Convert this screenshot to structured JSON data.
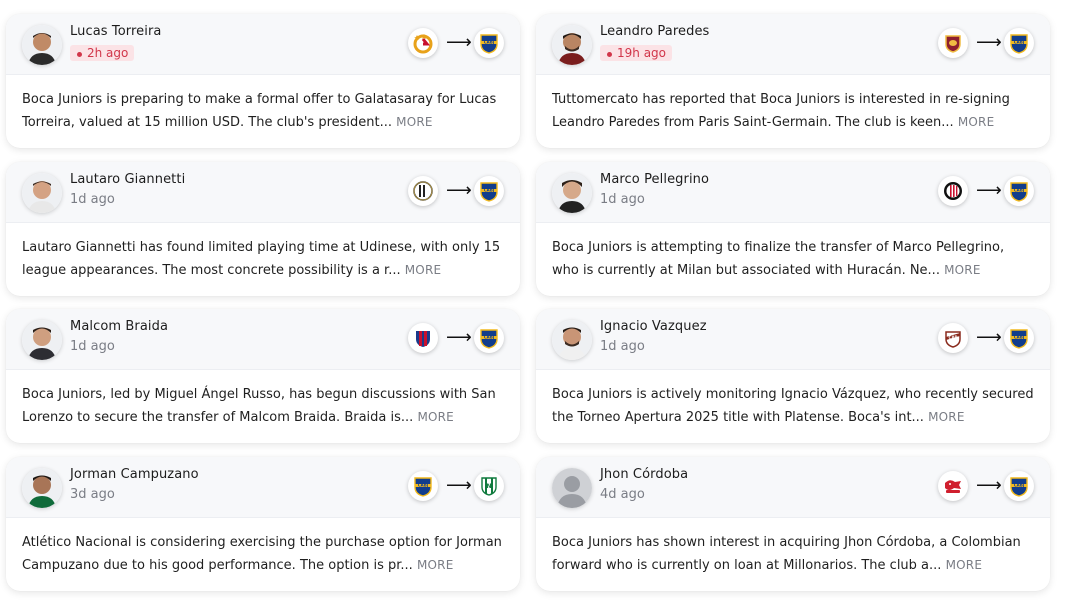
{
  "cards": [
    {
      "player": "Lucas Torreira",
      "time": "2h ago",
      "from_club": "galatasaray-crest-icon",
      "to_club": "boca-juniors-crest-icon",
      "arrow": "⟶",
      "summary": "Boca Juniors is preparing to make a formal offer to Galatasaray for Lucas Torreira, valued at 15 million USD. The club's president...",
      "more": "MORE"
    },
    {
      "player": "Leandro Paredes",
      "time": "19h ago",
      "from_club": "as-roma-crest-icon",
      "to_club": "boca-juniors-crest-icon",
      "arrow": "⟶",
      "summary": "Tuttomercato has reported that Boca Juniors is interested in re-signing Leandro Paredes from Paris Saint-Germain. The club is keen...",
      "more": "MORE"
    },
    {
      "player": "Lautaro Giannetti",
      "time": "1d ago",
      "from_club": "udinese-crest-icon",
      "to_club": "boca-juniors-crest-icon",
      "arrow": "⟶",
      "summary": "Lautaro Giannetti has found limited playing time at Udinese, with only 15 league appearances. The most concrete possibility is a r...",
      "more": "MORE"
    },
    {
      "player": "Marco Pellegrino",
      "time": "1d ago",
      "from_club": "ac-milan-crest-icon",
      "to_club": "boca-juniors-crest-icon",
      "arrow": "⟶",
      "summary": "Boca Juniors is attempting to finalize the transfer of Marco Pellegrino, who is currently at Milan but associated with Huracán. Ne...",
      "more": "MORE"
    },
    {
      "player": "Malcom Braida",
      "time": "1d ago",
      "from_club": "san-lorenzo-crest-icon",
      "to_club": "boca-juniors-crest-icon",
      "arrow": "⟶",
      "summary": "Boca Juniors, led by Miguel Ángel Russo, has begun discussions with San Lorenzo to secure the transfer of Malcom Braida. Braida is...",
      "more": "MORE"
    },
    {
      "player": "Ignacio Vazquez",
      "time": "1d ago",
      "from_club": "platense-crest-icon",
      "to_club": "boca-juniors-crest-icon",
      "arrow": "⟶",
      "summary": "Boca Juniors is actively monitoring Ignacio Vázquez, who recently secured the Torneo Apertura 2025 title with Platense. Boca's int...",
      "more": "MORE"
    },
    {
      "player": "Jorman Campuzano",
      "time": "3d ago",
      "from_club": "boca-juniors-crest-icon",
      "to_club": "atletico-nacional-crest-icon",
      "arrow": "⟶",
      "summary": "Atlético Nacional is considering exercising the purchase option for Jorman Campuzano due to his good performance. The option is pr...",
      "more": "MORE"
    },
    {
      "player": "Jhon Córdoba",
      "time": "4d ago",
      "from_club": "krasnodar-crest-icon",
      "to_club": "boca-juniors-crest-icon",
      "arrow": "⟶",
      "summary": "Boca Juniors has shown interest in acquiring Jhon Córdoba, a Colombian forward who is currently on loan at Millonarios. The club a...",
      "more": "MORE"
    }
  ],
  "colors": {
    "recent_badge_bg": "#fbe3e6",
    "recent_badge_text": "#d1364a",
    "boca_blue": "#123d8c",
    "boca_gold": "#f2b91d"
  }
}
